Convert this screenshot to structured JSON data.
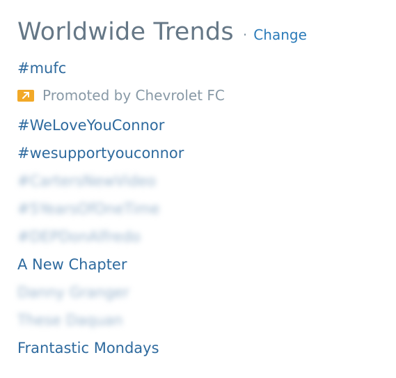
{
  "header": {
    "title": "Worldwide Trends",
    "separator": "·",
    "change_label": "Change"
  },
  "promoted": {
    "text": "Promoted by Chevrolet FC",
    "icon": "promoted-arrow-icon",
    "icon_color": "#f2a928"
  },
  "trends": [
    "#mufc",
    "#WeLoveYouConnor",
    "#wesupportyouconnor",
    "#CartersNewVideo",
    "#5YearsOfOneTime",
    "#DEPDonAlfredo",
    "A New Chapter",
    "Danny Granger",
    "These Daquan",
    "Frantastic Mondays"
  ],
  "colors": {
    "trend_link": "#2e6a9e",
    "title": "#657786",
    "change_link": "#2b7bb9",
    "muted_text": "#8899a6"
  }
}
